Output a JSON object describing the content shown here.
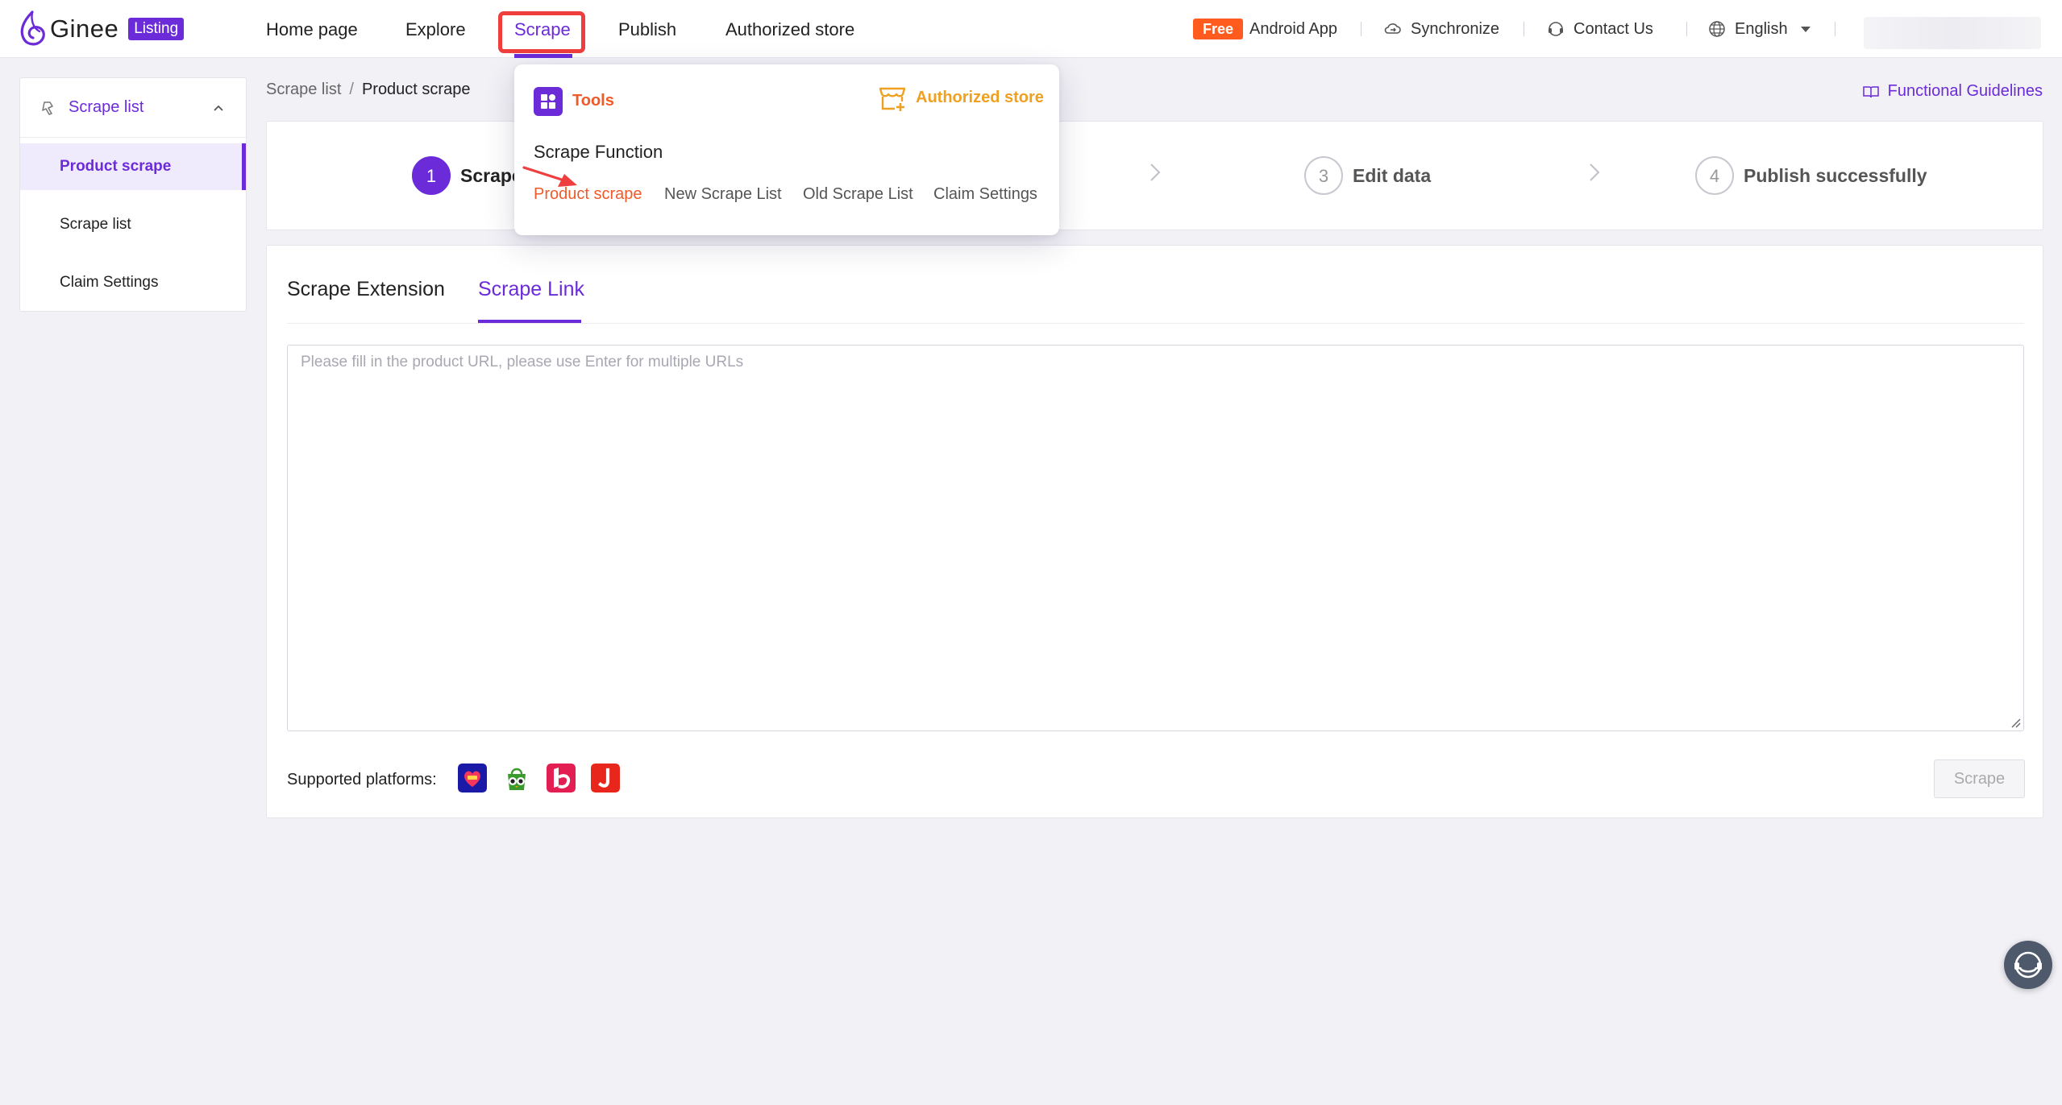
{
  "brand": {
    "name": "Ginee",
    "badge": "Listing"
  },
  "nav": {
    "home": "Home page",
    "explore": "Explore",
    "scrape": "Scrape",
    "publish": "Publish",
    "authorized_store": "Authorized store"
  },
  "header_tools": {
    "free_badge": "Free",
    "android_app": "Android App",
    "synchronize": "Synchronize",
    "contact_us": "Contact Us",
    "language": "English"
  },
  "sidebar": {
    "header": "Scrape list",
    "items": [
      {
        "label": "Product scrape",
        "active": true
      },
      {
        "label": "Scrape list",
        "active": false
      },
      {
        "label": "Claim Settings",
        "active": false
      }
    ]
  },
  "breadcrumb": {
    "parent": "Scrape list",
    "separator": "/",
    "current": "Product scrape"
  },
  "guidelines": "Functional Guidelines",
  "steps": [
    {
      "num": "1",
      "label": "Scrape",
      "active": true
    },
    {
      "num": "3",
      "label": "Edit data",
      "active": false
    },
    {
      "num": "4",
      "label": "Publish successfully",
      "active": false
    }
  ],
  "tabs": {
    "extension": "Scrape Extension",
    "link": "Scrape Link",
    "active": "link"
  },
  "url_input": {
    "placeholder": "Please fill in the product URL, please use Enter for multiple URLs",
    "value": ""
  },
  "platforms": {
    "label": "Supported platforms:",
    "icons": [
      "lazada-icon",
      "tokopedia-icon",
      "bukalapak-icon",
      "jd-icon"
    ]
  },
  "scrape_button": "Scrape",
  "dropdown": {
    "tools_label": "Tools",
    "store_label": "Authorized store",
    "section_title": "Scrape Function",
    "links": [
      "Product scrape",
      "New Scrape List",
      "Old Scrape List",
      "Claim Settings"
    ]
  },
  "colors": {
    "primary": "#6b2bd9",
    "accent_orange": "#ef5a2a",
    "accent_yellow": "#f0a020",
    "highlight_red": "#ef3e3e"
  }
}
